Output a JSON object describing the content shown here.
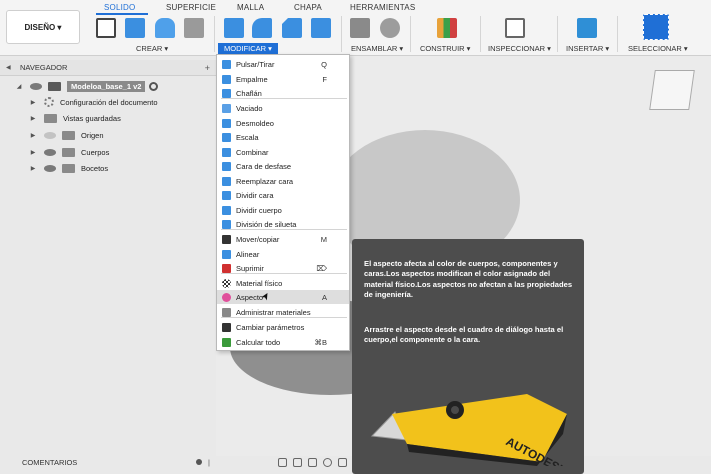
{
  "toolbar": {
    "design_label": "DISEÑO ▾",
    "tabs": [
      "SOLIDO",
      "SUPERFICIE",
      "MALLA",
      "CHAPA",
      "HERRAMIENTAS"
    ],
    "groups": [
      "CREAR ▾",
      "MODIFICAR ▾",
      "ENSAMBLAR ▾",
      "CONSTRUIR ▾",
      "INSPECCIONAR ▾",
      "INSERTAR ▾",
      "SELECCIONAR ▾"
    ]
  },
  "navigator": {
    "title": "NAVEGADOR",
    "items": [
      {
        "label": "Modeloa_base_1 v2"
      },
      {
        "label": "Configuración del documento"
      },
      {
        "label": "Vistas guardadas"
      },
      {
        "label": "Origen"
      },
      {
        "label": "Cuerpos"
      },
      {
        "label": "Bocetos"
      }
    ]
  },
  "menu": {
    "items": [
      {
        "label": "Pulsar/Tirar",
        "shortcut": "Q",
        "icon": "press-pull-icon",
        "color": "#3b8fe0"
      },
      {
        "label": "Empalme",
        "shortcut": "F",
        "icon": "fillet-icon",
        "color": "#3b8fe0"
      },
      {
        "label": "Chaflán",
        "shortcut": "",
        "icon": "chamfer-icon",
        "color": "#3b8fe0"
      },
      {
        "label": "Vaciado",
        "shortcut": "",
        "icon": "shell-icon",
        "color": "#5aa0e6"
      },
      {
        "label": "Desmoldeo",
        "shortcut": "",
        "icon": "draft-icon",
        "color": "#3b8fe0"
      },
      {
        "label": "Escala",
        "shortcut": "",
        "icon": "scale-icon",
        "color": "#3b8fe0"
      },
      {
        "label": "Combinar",
        "shortcut": "",
        "icon": "combine-icon",
        "color": "#3b8fe0"
      },
      {
        "label": "Cara de desfase",
        "shortcut": "",
        "icon": "offset-face-icon",
        "color": "#3b8fe0"
      },
      {
        "label": "Reemplazar cara",
        "shortcut": "",
        "icon": "replace-face-icon",
        "color": "#3b8fe0"
      },
      {
        "label": "Dividir cara",
        "shortcut": "",
        "icon": "split-face-icon",
        "color": "#3b8fe0"
      },
      {
        "label": "Dividir cuerpo",
        "shortcut": "",
        "icon": "split-body-icon",
        "color": "#3b8fe0"
      },
      {
        "label": "División de silueta",
        "shortcut": "",
        "icon": "silhouette-split-icon",
        "color": "#3b8fe0"
      },
      {
        "label": "Mover/copiar",
        "shortcut": "M",
        "icon": "move-icon",
        "color": "#333333"
      },
      {
        "label": "Alinear",
        "shortcut": "",
        "icon": "align-icon",
        "color": "#3b8fe0"
      },
      {
        "label": "Suprimir",
        "shortcut": "⌦",
        "icon": "delete-icon",
        "color": "#d03030"
      },
      {
        "label": "Material físico",
        "shortcut": "",
        "icon": "physical-material-icon",
        "color": "#333333"
      },
      {
        "label": "Aspecto",
        "shortcut": "A",
        "icon": "appearance-icon",
        "color": "#e0509b"
      },
      {
        "label": "Administrar materiales",
        "shortcut": "",
        "icon": "manage-materials-icon",
        "color": "#888888"
      },
      {
        "label": "Cambiar parámetros",
        "shortcut": "",
        "icon": "fx-icon",
        "color": "#333333"
      },
      {
        "label": "Calcular todo",
        "shortcut": "⌘B",
        "icon": "compute-all-icon",
        "color": "#3a9a3a"
      }
    ]
  },
  "tooltip": {
    "text1": "El aspecto afecta al color de cuerpos, componentes y caras.Los aspectos modifican el color asignado del material físico.Los aspectos no afectan a las propiedades de ingeniería.",
    "text2": "Arrastre el aspecto desde el cuadro de diálogo hasta el cuerpo,el componente o la cara.",
    "knife_brand": "AUTODESK"
  },
  "comments": {
    "title": "COMENTARIOS"
  }
}
